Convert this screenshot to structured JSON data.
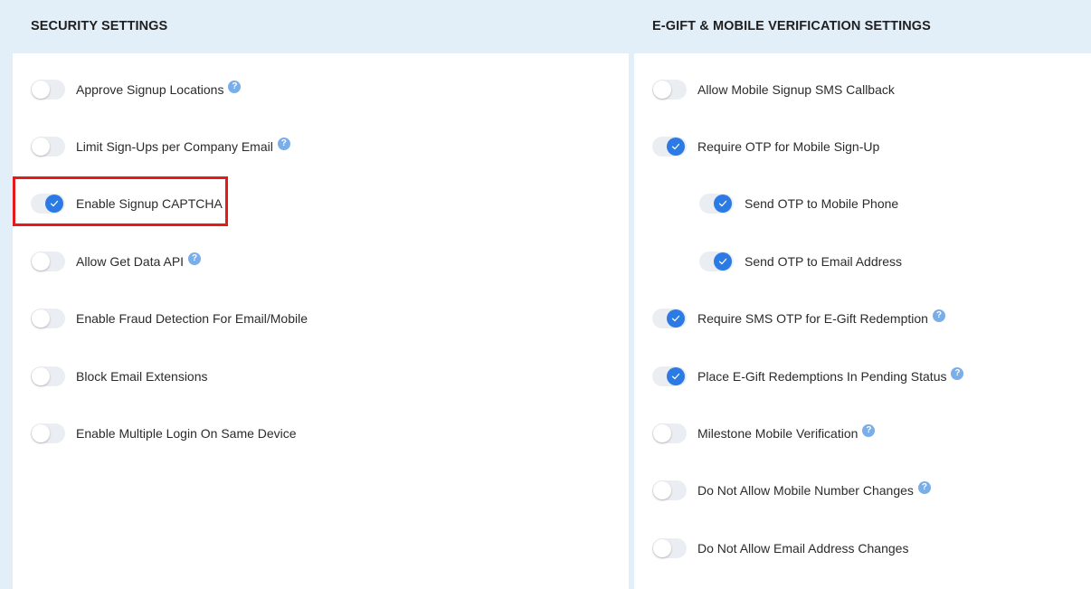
{
  "security": {
    "title": "SECURITY SETTINGS",
    "items": [
      {
        "label": "Approve Signup Locations",
        "on": false,
        "help": true
      },
      {
        "label": "Limit Sign-Ups per Company Email",
        "on": false,
        "help": true
      },
      {
        "label": "Enable Signup CAPTCHA",
        "on": true,
        "help": false
      },
      {
        "label": "Allow Get Data API",
        "on": false,
        "help": true
      },
      {
        "label": "Enable Fraud Detection For Email/Mobile",
        "on": false,
        "help": false
      },
      {
        "label": "Block Email Extensions",
        "on": false,
        "help": false
      },
      {
        "label": "Enable Multiple Login On Same Device",
        "on": false,
        "help": false
      }
    ]
  },
  "egift": {
    "title": "E-GIFT & MOBILE VERIFICATION SETTINGS",
    "items": [
      {
        "label": "Allow Mobile Signup SMS Callback",
        "on": false,
        "help": false
      },
      {
        "label": "Require OTP for Mobile Sign-Up",
        "on": true,
        "help": false
      },
      {
        "label": "Send OTP to Mobile Phone",
        "on": true,
        "help": false
      },
      {
        "label": "Send OTP to Email Address",
        "on": true,
        "help": false
      },
      {
        "label": "Require SMS OTP for E-Gift Redemption",
        "on": true,
        "help": true
      },
      {
        "label": "Place E-Gift Redemptions In Pending Status",
        "on": true,
        "help": true
      },
      {
        "label": "Milestone Mobile Verification",
        "on": false,
        "help": true
      },
      {
        "label": "Do Not Allow Mobile Number Changes",
        "on": false,
        "help": true
      },
      {
        "label": "Do Not Allow Email Address Changes",
        "on": false,
        "help": false
      }
    ]
  },
  "help_glyph": "?",
  "colors": {
    "accent": "#2c7be5",
    "highlight": "#e31b1b",
    "header_bg": "#e3eff8"
  }
}
